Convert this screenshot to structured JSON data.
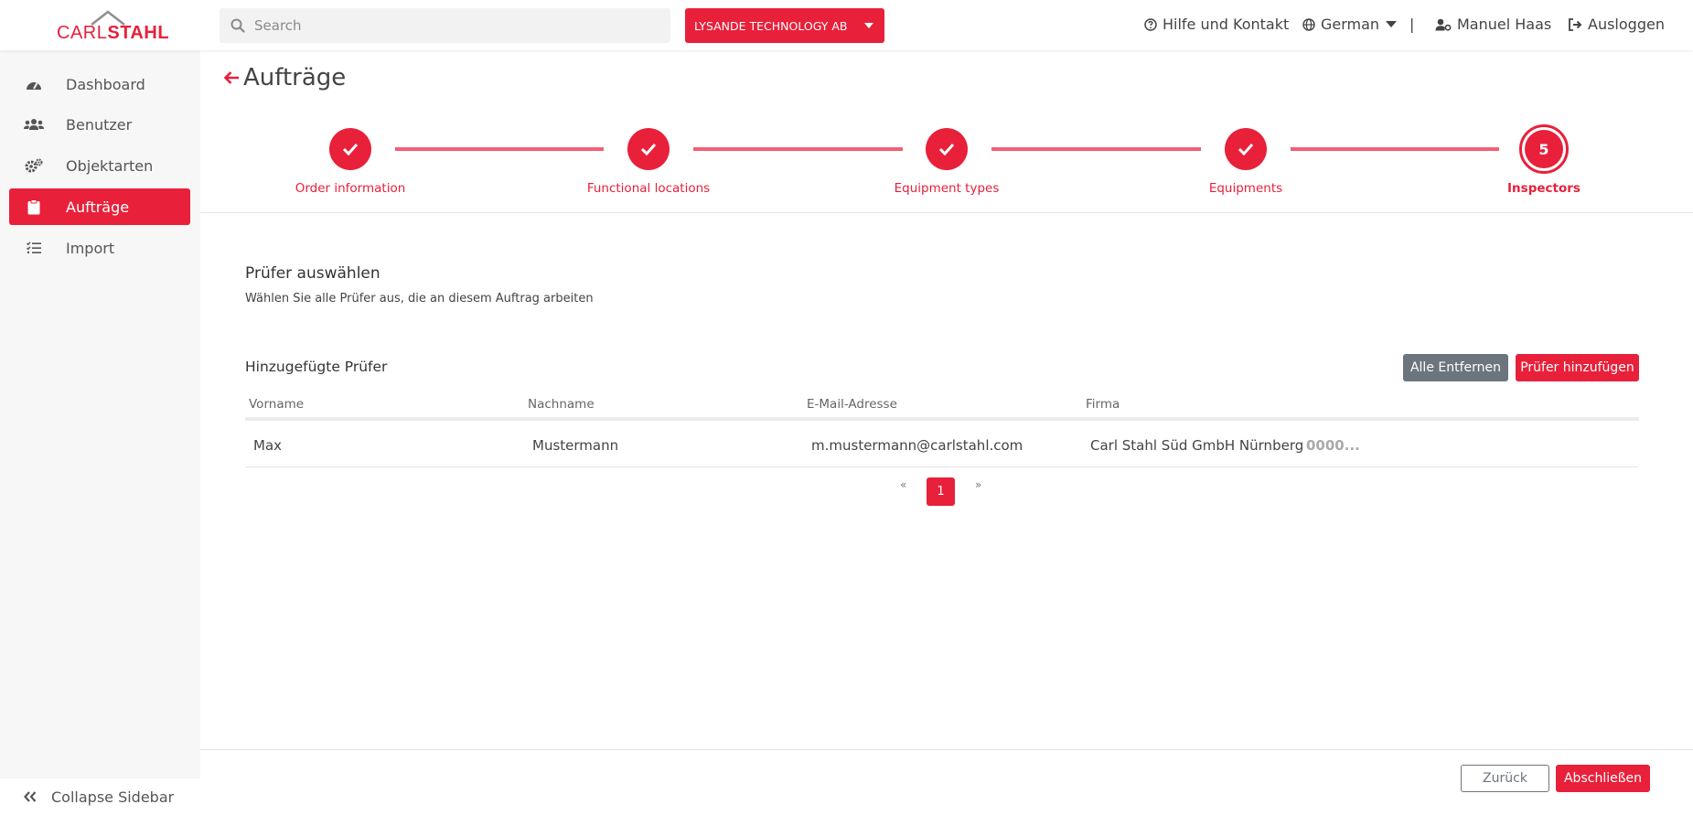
{
  "brand": {
    "logo_text_light": "CARL",
    "logo_text_bold": "STAHL",
    "accent_color": "#e8203a"
  },
  "search": {
    "placeholder": "Search"
  },
  "header": {
    "company": "LYSANDE TECHNOLOGY AB",
    "help": "Hilfe und Kontakt",
    "language": "German",
    "separator": "|",
    "user": "Manuel Haas",
    "logout": "Ausloggen"
  },
  "sidebar": {
    "items": [
      {
        "label": "Dashboard",
        "icon": "dashboard-gauge-icon"
      },
      {
        "label": "Benutzer",
        "icon": "users-icon"
      },
      {
        "label": "Objektarten",
        "icon": "gears-icon"
      },
      {
        "label": "Aufträge",
        "icon": "clipboard-icon",
        "active": true
      },
      {
        "label": "Import",
        "icon": "checklist-icon"
      }
    ],
    "collapse": "Collapse Sidebar"
  },
  "page": {
    "title": "Aufträge"
  },
  "stepper": {
    "steps": [
      {
        "label": "Order information",
        "state": "done"
      },
      {
        "label": "Functional locations",
        "state": "done"
      },
      {
        "label": "Equipment types",
        "state": "done"
      },
      {
        "label": "Equipments",
        "state": "done"
      },
      {
        "label": "Inspectors",
        "state": "current",
        "number": "5"
      }
    ]
  },
  "section": {
    "title": "Prüfer auswählen",
    "subtitle": "Wählen Sie alle Prüfer aus, die an diesem Auftrag arbeiten"
  },
  "table": {
    "title": "Hinzugefügte Prüfer",
    "remove_all": "Alle Entfernen",
    "add": "Prüfer hinzufügen",
    "columns": [
      "Vorname",
      "Nachname",
      "E-Mail-Adresse",
      "Firma"
    ],
    "rows": [
      {
        "first": "Max",
        "last": "Mustermann",
        "email": "m.mustermann@carlstahl.com",
        "company": "Carl Stahl Süd GmbH Nürnberg",
        "extra": "0000..."
      }
    ]
  },
  "pagination": {
    "prev": "«",
    "current": "1",
    "next": "»"
  },
  "footer": {
    "back": "Zurück",
    "finish": "Abschließen"
  }
}
